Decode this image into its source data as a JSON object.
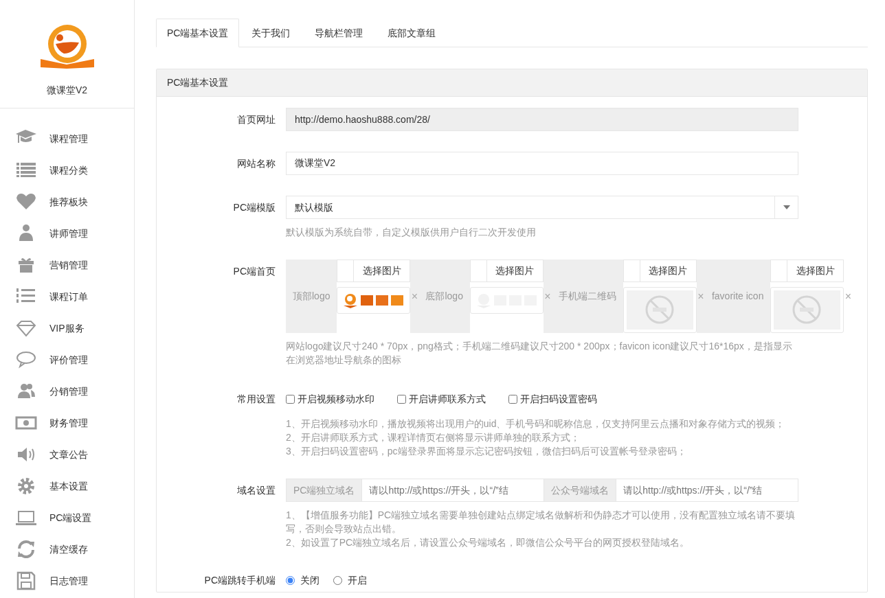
{
  "sidebar": {
    "brand": "微课堂V2",
    "items": [
      {
        "label": "课程管理"
      },
      {
        "label": "课程分类"
      },
      {
        "label": "推荐板块"
      },
      {
        "label": "讲师管理"
      },
      {
        "label": "营销管理"
      },
      {
        "label": "课程订单"
      },
      {
        "label": "VIP服务"
      },
      {
        "label": "评价管理"
      },
      {
        "label": "分销管理"
      },
      {
        "label": "财务管理"
      },
      {
        "label": "文章公告"
      },
      {
        "label": "基本设置"
      },
      {
        "label": "PC端设置"
      },
      {
        "label": "清空缓存"
      },
      {
        "label": "日志管理"
      }
    ]
  },
  "tabs": [
    {
      "label": "PC端基本设置",
      "selected": true
    },
    {
      "label": "关于我们",
      "selected": false
    },
    {
      "label": "导航栏管理",
      "selected": false
    },
    {
      "label": "底部文章组",
      "selected": false
    }
  ],
  "panel": {
    "title": "PC端基本设置",
    "rows": [
      {
        "kind": "readonly",
        "label": "首页网址",
        "value": "http://demo.haoshu888.com/28/"
      },
      {
        "kind": "input",
        "label": "网站名称",
        "value": "微课堂V2"
      },
      {
        "kind": "select",
        "label": "PC端模版",
        "value": "默认模版",
        "help": [
          "默认模版为系统自带，自定义模版供用户自行二次开发使用"
        ]
      },
      {
        "kind": "images",
        "label": "PC端首页",
        "images": [
          {
            "label": "顶部logo",
            "button": "选择图片",
            "remove": "×"
          },
          {
            "label": "底部logo",
            "button": "选择图片",
            "remove": "×"
          },
          {
            "label": "手机端二维码",
            "button": "选择图片",
            "remove": "×"
          },
          {
            "label": "favorite icon",
            "button": "选择图片",
            "remove": "×"
          }
        ],
        "help": [
          "网站logo建议尺寸240 * 70px，png格式；手机端二维码建议尺寸200 * 200px；favicon icon建议尺寸16*16px，是指显示在浏览器地址导航条的图标"
        ]
      },
      {
        "kind": "checkboxes",
        "label": "常用设置",
        "options": [
          {
            "label": "开启视频移动水印",
            "checked": false
          },
          {
            "label": "开启讲师联系方式",
            "checked": false
          },
          {
            "label": "开启扫码设置密码",
            "checked": false
          }
        ],
        "help": [
          "1、开启视频移动水印，播放视频将出现用户的uid、手机号码和昵称信息，仅支持阿里云点播和对象存储方式的视频；",
          "2、开启讲师联系方式，课程详情页右侧将显示讲师单独的联系方式；",
          "3、开启扫码设置密码，pc端登录界面将显示忘记密码按钮，微信扫码后可设置帐号登录密码；"
        ]
      },
      {
        "kind": "domains",
        "label": "域名设置",
        "fields": [
          {
            "addon": "PC端独立域名",
            "placeholder": "请以http://或https://开头，以“/”结"
          },
          {
            "addon": "公众号端域名",
            "placeholder": "请以http://或https://开头，以“/”结"
          }
        ],
        "help": [
          "1、【增值服务功能】PC端独立域名需要单独创建站点绑定域名做解析和伪静态才可以使用，没有配置独立域名请不要填写，否则会导致站点出错。",
          "2、如设置了PC端独立域名后，请设置公众号端域名，即微信公众号平台的网页授权登陆域名。"
        ]
      },
      {
        "kind": "radios",
        "label": "PC端跳转手机端",
        "options": [
          {
            "label": "关闭",
            "selected": true
          },
          {
            "label": "开启",
            "selected": false
          }
        ]
      }
    ]
  }
}
